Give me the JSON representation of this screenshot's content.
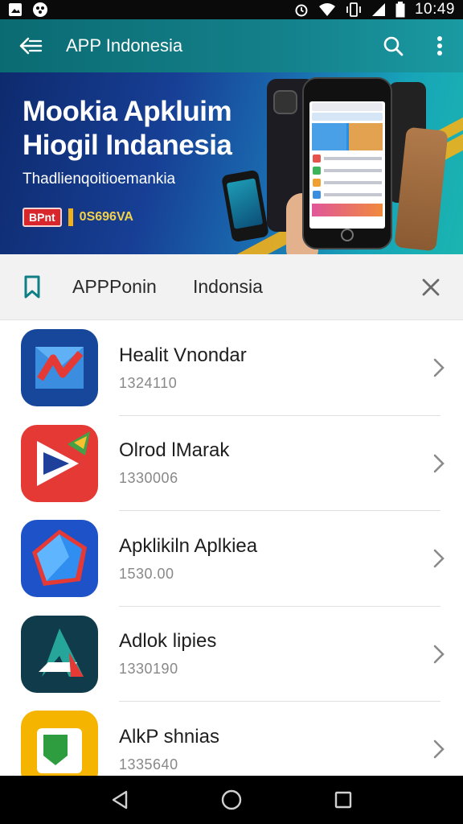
{
  "status_bar": {
    "time": "10:49",
    "icons": [
      "photo-icon",
      "app-icon",
      "alarm-icon",
      "wifi-icon",
      "vibrate-icon",
      "signal-icon",
      "battery-icon"
    ]
  },
  "app_bar": {
    "title": "APP Indonesia",
    "back_icon": "back-arrow-icon",
    "search_icon": "search-icon",
    "menu_icon": "more-vert-icon"
  },
  "banner": {
    "title_line1": "Mookia Apkluim",
    "title_line2": "Hiogil Indanesia",
    "subtitle": "Thadlienqoitioemankia",
    "tag_label": "BPnt",
    "code": "0S696VA"
  },
  "filter": {
    "label1": "APPPonin",
    "label2": "Indonsia",
    "bookmark_icon": "bookmark-icon",
    "close_icon": "close-icon"
  },
  "apps": [
    {
      "name": "Healit Vnondar",
      "meta": "1324110"
    },
    {
      "name": "Olrod lMarak",
      "meta": "1330006"
    },
    {
      "name": "Apklikiln Aplkiea",
      "meta": "1530.00"
    },
    {
      "name": "Adlok lipies",
      "meta": "1330190"
    },
    {
      "name": "AlkP shnias",
      "meta": "1335640"
    }
  ],
  "nav": {
    "back_icon": "nav-back-icon",
    "home_icon": "nav-home-icon",
    "recents_icon": "nav-recents-icon"
  }
}
